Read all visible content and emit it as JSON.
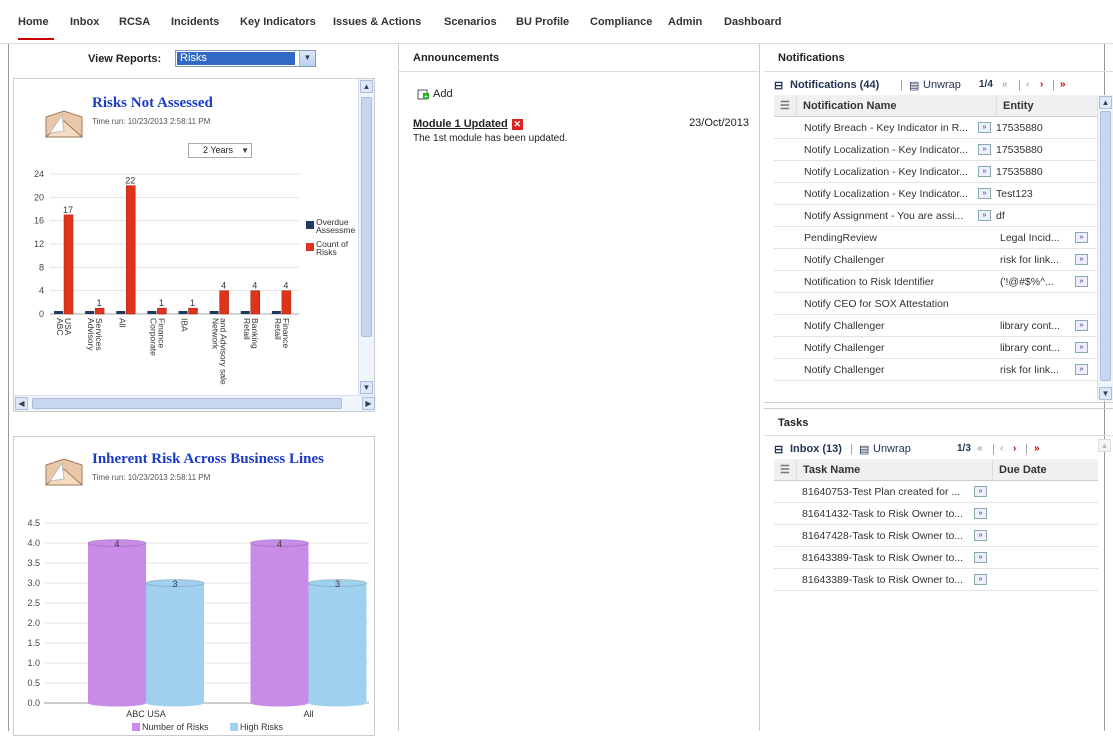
{
  "tabs": [
    "Home",
    "Inbox",
    "RCSA",
    "Incidents",
    "Key Indicators",
    "Issues & Actions",
    "Scenarios",
    "BU Profile",
    "Compliance",
    "Admin",
    "Dashboard"
  ],
  "view_reports": {
    "label": "View Reports:",
    "value": "Risks"
  },
  "risks_not_assessed": {
    "title": "Risks Not Assessed",
    "time_run": "Time run: 10/23/2013 2:58:11 PM",
    "period": "2 Years",
    "chart_data": {
      "type": "bar",
      "categories": [
        "ABC USA",
        "Advisory Services",
        "All",
        "Corporate Finance",
        "IBA",
        "Network and Advisory sale",
        "Retail Banking",
        "Retail Finance"
      ],
      "series": [
        {
          "name": "Overdue Assessme",
          "values": [
            0,
            0,
            0,
            0,
            0,
            0,
            0,
            0
          ],
          "color": "#1f3a5f"
        },
        {
          "name": "Count of Risks",
          "values": [
            17,
            1,
            22,
            1,
            1,
            4,
            4,
            4
          ],
          "color": "#e0341a"
        }
      ],
      "ylim": [
        0,
        24
      ],
      "yticks": [
        "0",
        "4",
        "8",
        "12",
        "16",
        "20",
        "24"
      ],
      "data_labels": [
        "17",
        "1",
        "22",
        "1",
        "1",
        "4",
        "4",
        "4"
      ],
      "legend": "right"
    }
  },
  "inherent_risk": {
    "title": "Inherent Risk Across Business Lines",
    "time_run": "Time run: 10/23/2013 2:58:11 PM",
    "chart_data": {
      "type": "bar",
      "categories": [
        "ABC USA",
        "All"
      ],
      "series": [
        {
          "name": "Number of Risks",
          "values": [
            4,
            4
          ],
          "color": "#c88be8"
        },
        {
          "name": "High Risks",
          "values": [
            3,
            3
          ],
          "color": "#9fd1ee"
        }
      ],
      "ylim": [
        0,
        4.5
      ],
      "yticks": [
        "0.0",
        "0.5",
        "1.0",
        "1.5",
        "2.0",
        "2.5",
        "3.0",
        "3.5",
        "4.0",
        "4.5"
      ],
      "data_labels": [
        "4",
        "3",
        "4",
        "3"
      ],
      "legend": "bottom"
    }
  },
  "announcements": {
    "header": "Announcements",
    "add_label": "Add",
    "item": {
      "title": "Module 1 Updated",
      "date": "23/Oct/2013",
      "body": "The 1st module has been updated."
    }
  },
  "notifications": {
    "header": "Notifications",
    "grid_title": "Notifications (44)",
    "unwrap": "Unwrap",
    "page": "1/4",
    "columns": [
      "Notification Name",
      "Entity"
    ],
    "rows": [
      {
        "name": "Notify Breach - Key Indicator in R...",
        "entity": "17535880",
        "name_btn": true,
        "entity_btn": false
      },
      {
        "name": "Notify Localization - Key Indicator...",
        "entity": "17535880",
        "name_btn": true,
        "entity_btn": false
      },
      {
        "name": "Notify Localization - Key Indicator...",
        "entity": "17535880",
        "name_btn": true,
        "entity_btn": false
      },
      {
        "name": "Notify Localization - Key Indicator...",
        "entity": "Test123",
        "name_btn": true,
        "entity_btn": false
      },
      {
        "name": "Notify Assignment - You are assi...",
        "entity": "df",
        "name_btn": true,
        "entity_btn": false
      },
      {
        "name": "PendingReview",
        "entity": "Legal Incid...",
        "name_btn": false,
        "entity_btn": true
      },
      {
        "name": "Notify Challenger",
        "entity": "risk for link...",
        "name_btn": false,
        "entity_btn": true
      },
      {
        "name": "Notification to Risk Identifier",
        "entity": "('!@#$%^...",
        "name_btn": false,
        "entity_btn": true
      },
      {
        "name": "Notify CEO for SOX Attestation",
        "entity": "",
        "name_btn": false,
        "entity_btn": false
      },
      {
        "name": "Notify Challenger",
        "entity": "library cont...",
        "name_btn": false,
        "entity_btn": true
      },
      {
        "name": "Notify Challenger",
        "entity": "library cont...",
        "name_btn": false,
        "entity_btn": true
      },
      {
        "name": "Notify Challenger",
        "entity": "risk for link...",
        "name_btn": false,
        "entity_btn": true
      }
    ]
  },
  "tasks": {
    "header": "Tasks",
    "grid_title": "Inbox (13)",
    "unwrap": "Unwrap",
    "page": "1/3",
    "columns": [
      "Task Name",
      "Due Date"
    ],
    "rows": [
      {
        "name": "81640753-Test Plan created for ..."
      },
      {
        "name": "81641432-Task to Risk Owner to..."
      },
      {
        "name": "81647428-Task to Risk Owner to..."
      },
      {
        "name": "81643389-Task to Risk Owner to..."
      },
      {
        "name": "81643389-Task to Risk Owner to..."
      }
    ]
  }
}
